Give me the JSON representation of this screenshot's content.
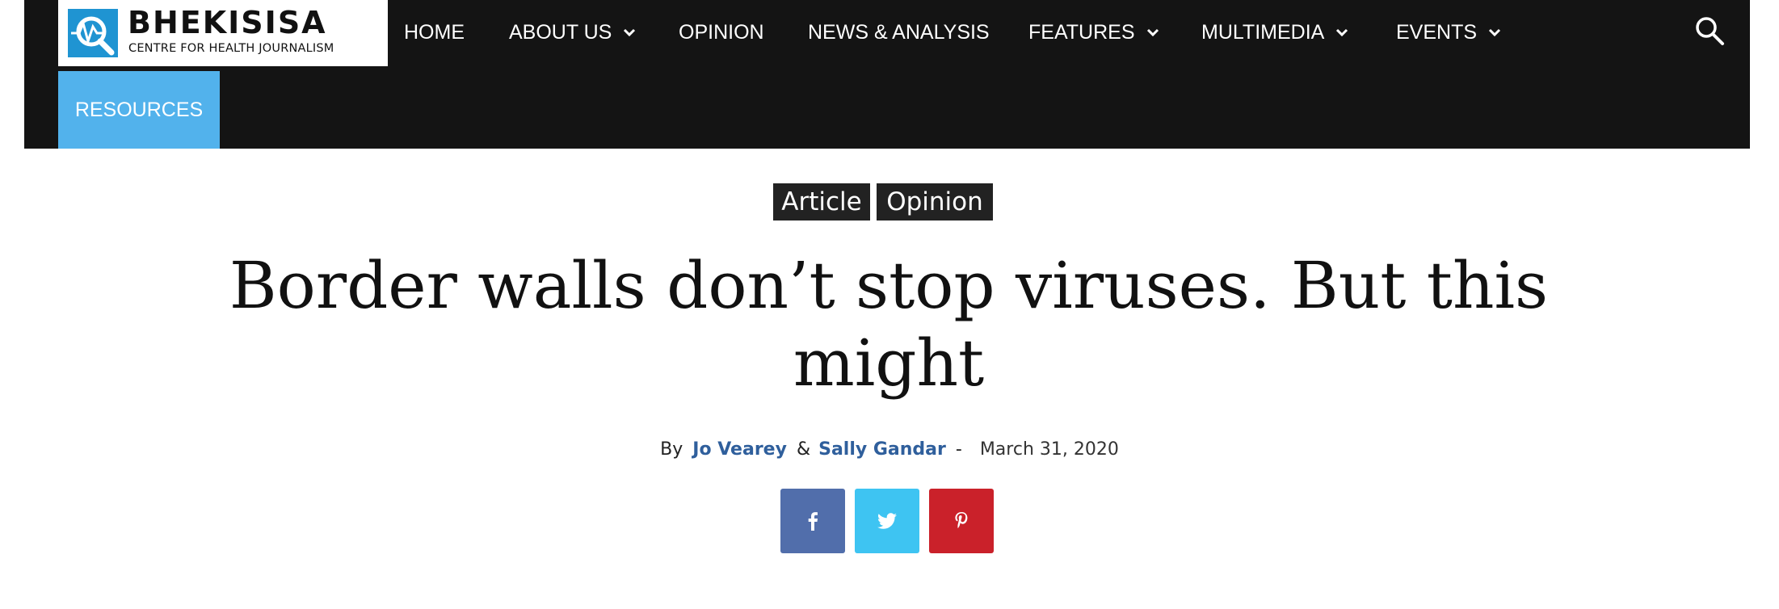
{
  "site": {
    "logo_title": "BHEKISISA",
    "logo_subtitle": "CENTRE FOR HEALTH JOURNALISM",
    "logo_icon": "magnifier-heartbeat-icon",
    "accent_color": "#52b2ec"
  },
  "nav": {
    "items": [
      {
        "label": "HOME",
        "has_dropdown": false
      },
      {
        "label": "ABOUT US",
        "has_dropdown": true
      },
      {
        "label": "OPINION",
        "has_dropdown": false
      },
      {
        "label": "NEWS & ANALYSIS",
        "has_dropdown": false
      },
      {
        "label": "FEATURES",
        "has_dropdown": true
      },
      {
        "label": "MULTIMEDIA",
        "has_dropdown": true
      },
      {
        "label": "EVENTS",
        "has_dropdown": true
      }
    ],
    "resources_label": "RESOURCES",
    "search_icon": "search-icon"
  },
  "article": {
    "tags": [
      "Article",
      "Opinion"
    ],
    "title": "Border walls don’t stop viruses. But this might",
    "byline": {
      "by": "By",
      "author1": "Jo Vearey",
      "amp": "&",
      "author2": "Sally Gandar",
      "dash": "-",
      "date": "March 31, 2020"
    },
    "share": [
      {
        "icon": "facebook-icon",
        "color": "#516eab"
      },
      {
        "icon": "twitter-icon",
        "color": "#3ec4f2"
      },
      {
        "icon": "pinterest-icon",
        "color": "#ca212a"
      }
    ]
  }
}
